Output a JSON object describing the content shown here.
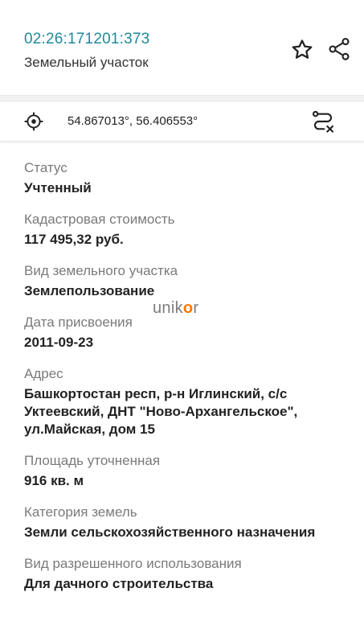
{
  "header": {
    "cadastral_number": "02:26:171201:373",
    "subtitle": "Земельный участок"
  },
  "coords_bar": {
    "coordinates": "54.867013°, 56.406553°"
  },
  "cut_off_text": "02 26 171201 373",
  "fields": [
    {
      "label": "Статус",
      "value": "Учтенный"
    },
    {
      "label": "Кадастровая стоимость",
      "value": "117 495,32 руб."
    },
    {
      "label": "Вид земельного участка",
      "value": "Землепользование"
    },
    {
      "label": "Дата присвоения",
      "value": "2011-09-23"
    },
    {
      "label": "Адрес",
      "value": "Башкортостан респ, р-н Иглинский, с/с Уктеевский, ДНТ \"Ново-Архангельское\", ул.Майская, дом 15"
    },
    {
      "label": "Площадь уточненная",
      "value": "916 кв. м"
    },
    {
      "label": "Категория земель",
      "value": "Земли сельскохозяйственного назначения"
    },
    {
      "label": "Вид разрешенного использования",
      "value": "Для дачного строительства"
    }
  ],
  "watermark": {
    "part1": "unik",
    "part2": "o",
    "part3": "r"
  },
  "colors": {
    "accent": "#1f8a9b",
    "watermark_accent": "#ff7a00"
  }
}
